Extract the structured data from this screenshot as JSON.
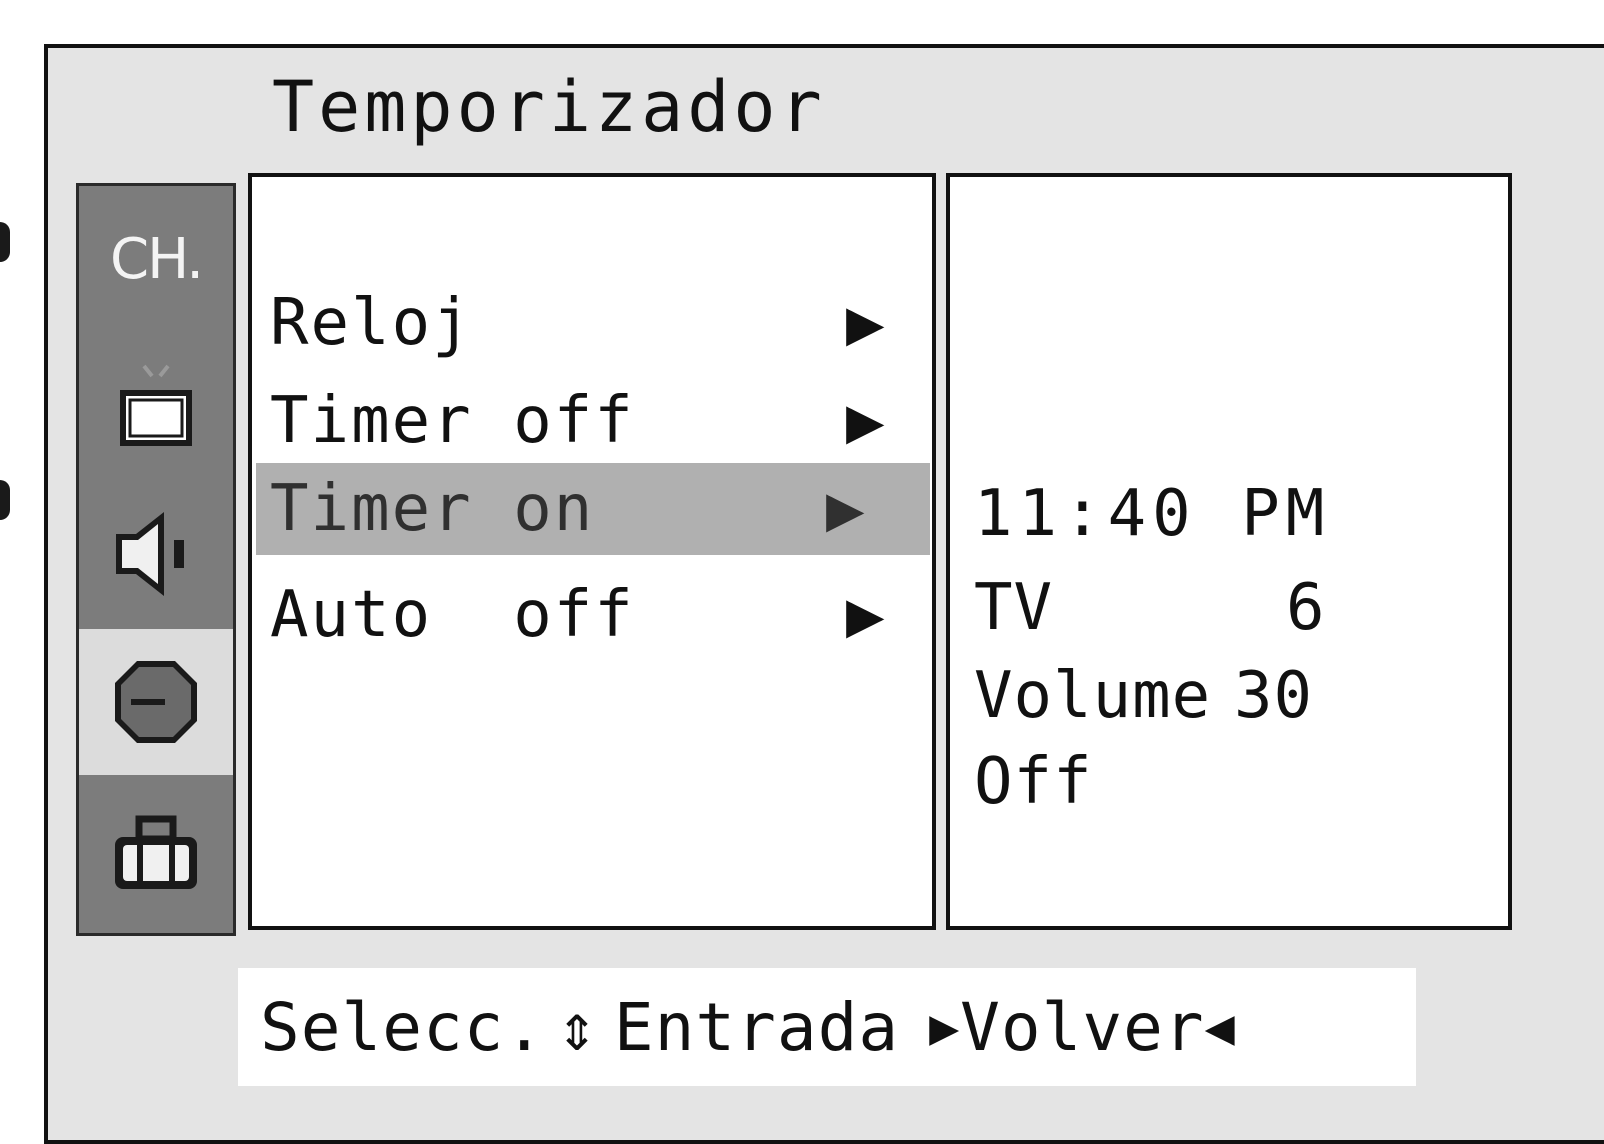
{
  "title": "Temporizador",
  "sidebar": {
    "items": [
      {
        "id": "ch",
        "label": "CH.",
        "icon": "channel-label"
      },
      {
        "id": "picture",
        "icon": "tv-icon"
      },
      {
        "id": "sound",
        "icon": "speaker-icon"
      },
      {
        "id": "time",
        "icon": "clock-icon",
        "active": true
      },
      {
        "id": "special",
        "icon": "toolbox-icon"
      }
    ]
  },
  "menu": {
    "items": [
      {
        "label": "Reloj",
        "arrow": "▶"
      },
      {
        "label": "Timer off",
        "arrow": "▶"
      },
      {
        "label": "Timer on",
        "arrow": "▶",
        "selected": true
      },
      {
        "label": "Auto  off",
        "arrow": "▶"
      }
    ]
  },
  "info": {
    "time": "11:40 PM",
    "source": "TV",
    "channel": "6",
    "volume_label": "Volume",
    "volume": "30",
    "state": "Off"
  },
  "footer": {
    "select_label": "Selecc.",
    "select_icon": "⇕",
    "enter_label": "Entrada",
    "enter_icon": "▶",
    "back_label": "Volver",
    "back_icon": "◀"
  }
}
